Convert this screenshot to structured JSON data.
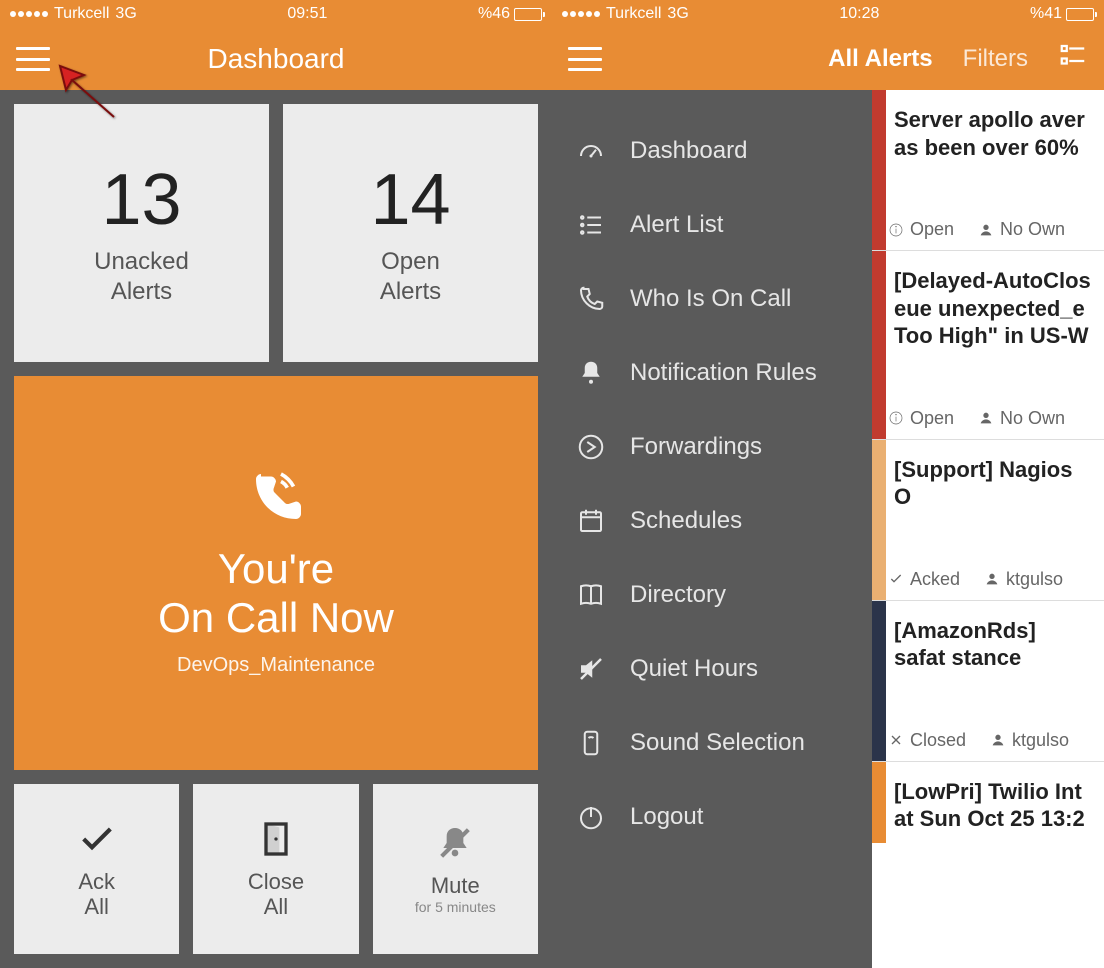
{
  "screen1": {
    "status": {
      "carrier": "Turkcell",
      "network": "3G",
      "time": "09:51",
      "battery_pct": "%46",
      "battery_fill": 46
    },
    "title": "Dashboard",
    "tiles": {
      "unacked": {
        "count": "13",
        "label_l1": "Unacked",
        "label_l2": "Alerts"
      },
      "open": {
        "count": "14",
        "label_l1": "Open",
        "label_l2": "Alerts"
      },
      "oncall": {
        "line1": "You're",
        "line2": "On Call Now",
        "schedule": "DevOps_Maintenance"
      },
      "ack": {
        "label_l1": "Ack",
        "label_l2": "All"
      },
      "close": {
        "label_l1": "Close",
        "label_l2": "All"
      },
      "mute": {
        "label": "Mute",
        "sub": "for 5 minutes"
      }
    }
  },
  "screen2": {
    "status": {
      "carrier": "Turkcell",
      "network": "3G",
      "time": "10:28",
      "battery_pct": "%41",
      "battery_fill": 41
    },
    "nav": {
      "tab1": "All Alerts",
      "tab2": "Filters"
    },
    "menu": [
      {
        "icon": "gauge",
        "label": "Dashboard"
      },
      {
        "icon": "list",
        "label": "Alert List"
      },
      {
        "icon": "phone",
        "label": "Who Is On Call"
      },
      {
        "icon": "bell",
        "label": "Notification Rules"
      },
      {
        "icon": "forward",
        "label": "Forwardings"
      },
      {
        "icon": "calendar",
        "label": "Schedules"
      },
      {
        "icon": "book",
        "label": "Directory"
      },
      {
        "icon": "mute",
        "label": "Quiet Hours"
      },
      {
        "icon": "sound",
        "label": "Sound Selection"
      },
      {
        "icon": "power",
        "label": "Logout"
      }
    ],
    "alerts": [
      {
        "stripe": "#c13b2f",
        "title": "Server apollo aver as been over 60%",
        "status": "Open",
        "owner": "No Own",
        "status_icon": "info",
        "owner_icon": "user"
      },
      {
        "stripe": "#c13b2f",
        "title": "[Delayed-AutoClos eue unexpected_e Too High\" in US-W",
        "status": "Open",
        "owner": "No Own",
        "status_icon": "info",
        "owner_icon": "user"
      },
      {
        "stripe": "#eab072",
        "title": "[Support] Nagios O",
        "status": "Acked",
        "owner": "ktgulso",
        "status_icon": "check",
        "owner_icon": "user"
      },
      {
        "stripe": "#2b344a",
        "title": "[AmazonRds] safat stance",
        "status": "Closed",
        "owner": "ktgulso",
        "status_icon": "x",
        "owner_icon": "user"
      },
      {
        "stripe": "#e88c34",
        "title": "[LowPri] Twilio Int at Sun Oct 25 13:2",
        "status": "",
        "owner": "",
        "status_icon": "",
        "owner_icon": ""
      }
    ]
  }
}
